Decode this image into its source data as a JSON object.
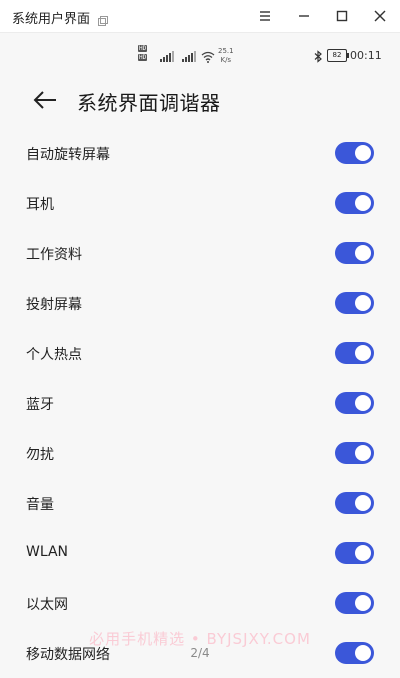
{
  "window": {
    "title": "系统用户界面",
    "icons": [
      "copy-icon",
      "menu-icon",
      "minimize-icon",
      "maximize-icon",
      "close-icon"
    ]
  },
  "status_bar": {
    "hd_badges": [
      "HD",
      "HD"
    ],
    "network_speed_value": "25.1",
    "network_speed_unit": "K/s",
    "battery": "82",
    "time": "00:11"
  },
  "header": {
    "title": "系统界面调谐器",
    "back_icon": "arrow-left-icon"
  },
  "settings": {
    "items": [
      {
        "label": "自动旋转屏幕",
        "enabled": true
      },
      {
        "label": "耳机",
        "enabled": true
      },
      {
        "label": "工作资料",
        "enabled": true
      },
      {
        "label": "投射屏幕",
        "enabled": true
      },
      {
        "label": "个人热点",
        "enabled": true
      },
      {
        "label": "蓝牙",
        "enabled": true
      },
      {
        "label": "勿扰",
        "enabled": true
      },
      {
        "label": "音量",
        "enabled": true
      },
      {
        "label": "WLAN",
        "enabled": true
      },
      {
        "label": "以太网",
        "enabled": true
      },
      {
        "label": "移动数据网络",
        "enabled": true
      }
    ]
  },
  "watermark": "必用手机精选 • BYJSJXY.COM",
  "page_indicator": "2/4",
  "colors": {
    "toggle_on": "#3b57d9",
    "background": "#f7f7f7"
  }
}
